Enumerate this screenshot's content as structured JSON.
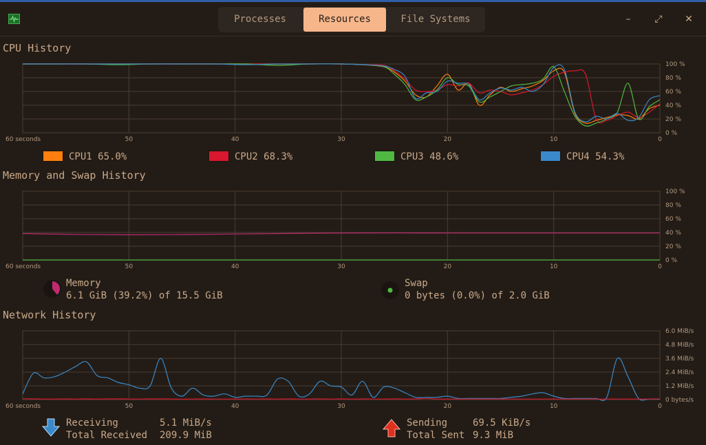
{
  "header": {
    "tabs": [
      {
        "label": "Processes",
        "active": false
      },
      {
        "label": "Resources",
        "active": true
      },
      {
        "label": "File Systems",
        "active": false
      }
    ],
    "window_buttons": {
      "minimize": "–",
      "maximize": "⤢",
      "close": "✕"
    }
  },
  "cpu": {
    "title": "CPU History",
    "legend": [
      {
        "label": "CPU1 65.0%",
        "color": "#ff7f0e"
      },
      {
        "label": "CPU2 68.3%",
        "color": "#d9172e"
      },
      {
        "label": "CPU3 48.6%",
        "color": "#4fb843"
      },
      {
        "label": "CPU4 54.3%",
        "color": "#3a89c9"
      }
    ]
  },
  "memory": {
    "title": "Memory and Swap History",
    "memory_label": "Memory",
    "memory_value": "6.1 GiB (39.2%) of 15.5 GiB",
    "memory_color": "#c02a70",
    "swap_label": "Swap",
    "swap_value": "0 bytes (0.0%) of 2.0 GiB",
    "swap_color": "#4fb843"
  },
  "network": {
    "title": "Network History",
    "receiving_label": "Receiving",
    "receiving_value": "5.1 MiB/s",
    "total_received_label": "Total Received",
    "total_received_value": "209.9 MiB",
    "sending_label": "Sending",
    "sending_value": "69.5 KiB/s",
    "total_sent_label": "Total Sent",
    "total_sent_value": "9.3 MiB",
    "receiving_color": "#3a89c9",
    "sending_color": "#d9172e"
  },
  "chart_data": [
    {
      "type": "line",
      "x_label_start": "60 seconds",
      "x_ticks": [
        "60 seconds",
        "50",
        "40",
        "30",
        "20",
        "10",
        "0"
      ],
      "xlim": [
        60,
        0
      ],
      "y_ticks": [
        "100 %",
        "80 %",
        "60 %",
        "40 %",
        "20 %",
        "0 %"
      ],
      "ylim": [
        0,
        100
      ],
      "x": [
        60,
        57,
        54,
        51,
        48,
        45,
        42,
        39,
        36,
        33,
        30,
        28,
        26,
        25,
        24,
        23,
        22,
        21,
        20,
        19,
        18,
        17,
        16,
        15,
        14,
        13,
        12,
        11,
        10,
        9,
        8,
        7,
        6,
        5,
        4,
        3,
        2,
        1,
        0
      ],
      "series": [
        {
          "name": "CPU1",
          "color": "#ff7f0e",
          "values": [
            100,
            100,
            100,
            100,
            100,
            100,
            100,
            100,
            100,
            100,
            100,
            99,
            96,
            88,
            75,
            55,
            52,
            68,
            85,
            62,
            72,
            40,
            55,
            66,
            60,
            64,
            68,
            76,
            90,
            88,
            28,
            14,
            18,
            22,
            26,
            25,
            20,
            35,
            40
          ]
        },
        {
          "name": "CPU2",
          "color": "#d9172e",
          "values": [
            100,
            100,
            100,
            100,
            100,
            100,
            100,
            100,
            100,
            100,
            100,
            99,
            98,
            90,
            78,
            62,
            60,
            62,
            70,
            68,
            72,
            58,
            62,
            60,
            55,
            58,
            62,
            70,
            82,
            88,
            90,
            85,
            20,
            18,
            25,
            30,
            22,
            30,
            42
          ]
        },
        {
          "name": "CPU3",
          "color": "#4fb843",
          "values": [
            100,
            100,
            100,
            99,
            100,
            100,
            100,
            100,
            98,
            100,
            100,
            99,
            96,
            85,
            70,
            48,
            52,
            62,
            80,
            70,
            68,
            45,
            52,
            60,
            68,
            70,
            72,
            78,
            96,
            60,
            24,
            10,
            14,
            20,
            30,
            72,
            20,
            38,
            48
          ]
        },
        {
          "name": "CPU4",
          "color": "#3a89c9",
          "values": [
            100,
            100,
            100,
            100,
            100,
            100,
            100,
            99,
            100,
            100,
            100,
            99,
            97,
            92,
            82,
            50,
            58,
            60,
            75,
            72,
            70,
            48,
            58,
            65,
            62,
            66,
            60,
            70,
            95,
            92,
            30,
            16,
            24,
            20,
            28,
            18,
            22,
            48,
            54
          ]
        }
      ]
    },
    {
      "type": "line",
      "x_ticks": [
        "60 seconds",
        "50",
        "40",
        "30",
        "20",
        "10",
        "0"
      ],
      "xlim": [
        60,
        0
      ],
      "y_ticks": [
        "100 %",
        "80 %",
        "60 %",
        "40 %",
        "20 %",
        "0 %"
      ],
      "ylim": [
        0,
        100
      ],
      "x": [
        60,
        55,
        50,
        45,
        40,
        35,
        30,
        25,
        20,
        15,
        10,
        5,
        0
      ],
      "series": [
        {
          "name": "Memory",
          "color": "#c02a70",
          "values": [
            38.5,
            37.2,
            36.6,
            37.0,
            37.8,
            38.6,
            39.2,
            39.3,
            39.2,
            39.2,
            39.2,
            39.2,
            39.2
          ]
        },
        {
          "name": "Swap",
          "color": "#4fb843",
          "values": [
            0,
            0,
            0,
            0,
            0,
            0,
            0,
            0,
            0,
            0,
            0,
            0,
            0
          ]
        }
      ]
    },
    {
      "type": "line",
      "x_ticks": [
        "60 seconds",
        "50",
        "40",
        "30",
        "20",
        "10",
        "0"
      ],
      "xlim": [
        60,
        0
      ],
      "y_ticks": [
        "6.0 MiB/s",
        "4.8 MiB/s",
        "3.6 MiB/s",
        "2.4 MiB/s",
        "1.2 MiB/s",
        "0 bytes/s"
      ],
      "ylim": [
        0,
        6.0
      ],
      "x": [
        60,
        59,
        58,
        57,
        56,
        55,
        54,
        53,
        52,
        51,
        50,
        49,
        48,
        47,
        46,
        45,
        44,
        43,
        42,
        41,
        40,
        39,
        38,
        37,
        36,
        35,
        34,
        33,
        32,
        31,
        30,
        29,
        28,
        27,
        26,
        25,
        24,
        23,
        22,
        21,
        20,
        19,
        18,
        17,
        16,
        15,
        14,
        13,
        12,
        11,
        10,
        9,
        8,
        7,
        6,
        5,
        4,
        3,
        2,
        1,
        0
      ],
      "series": [
        {
          "name": "Receiving",
          "color": "#3a89c9",
          "values": [
            0.5,
            2.3,
            1.9,
            2.0,
            2.4,
            2.9,
            3.3,
            2.1,
            1.9,
            1.5,
            1.3,
            1.0,
            1.2,
            3.6,
            1.0,
            0.3,
            1.0,
            0.4,
            0.3,
            0.5,
            0.2,
            0.3,
            0.3,
            0.4,
            1.8,
            1.6,
            0.3,
            0.5,
            1.6,
            1.2,
            1.1,
            0.4,
            1.6,
            0.2,
            1.1,
            1.0,
            0.6,
            0.2,
            0.2,
            0.2,
            0.3,
            0.1,
            0.1,
            0.1,
            0.1,
            0.1,
            0.2,
            0.3,
            0.5,
            0.6,
            0.3,
            0.1,
            0.1,
            0.1,
            0.1,
            0.2,
            3.6,
            2.0,
            0.1,
            0.05,
            0.05
          ]
        },
        {
          "name": "Sending",
          "color": "#d9172e",
          "values": [
            0.08,
            0.06,
            0.05,
            0.05,
            0.06,
            0.05,
            0.06,
            0.05,
            0.06,
            0.07,
            0.05,
            0.05,
            0.06,
            0.07,
            0.05,
            0.04,
            0.05,
            0.06,
            0.05,
            0.05,
            0.05,
            0.06,
            0.05,
            0.06,
            0.05,
            0.06,
            0.05,
            0.05,
            0.06,
            0.05,
            0.06,
            0.05,
            0.06,
            0.05,
            0.05,
            0.06,
            0.05,
            0.06,
            0.1,
            0.05,
            0.05,
            0.05,
            0.05,
            0.05,
            0.05,
            0.05,
            0.05,
            0.05,
            0.05,
            0.05,
            0.05,
            0.05,
            0.05,
            0.05,
            0.05,
            0.05,
            0.05,
            0.05,
            0.05,
            0.05,
            0.07
          ]
        }
      ]
    }
  ]
}
